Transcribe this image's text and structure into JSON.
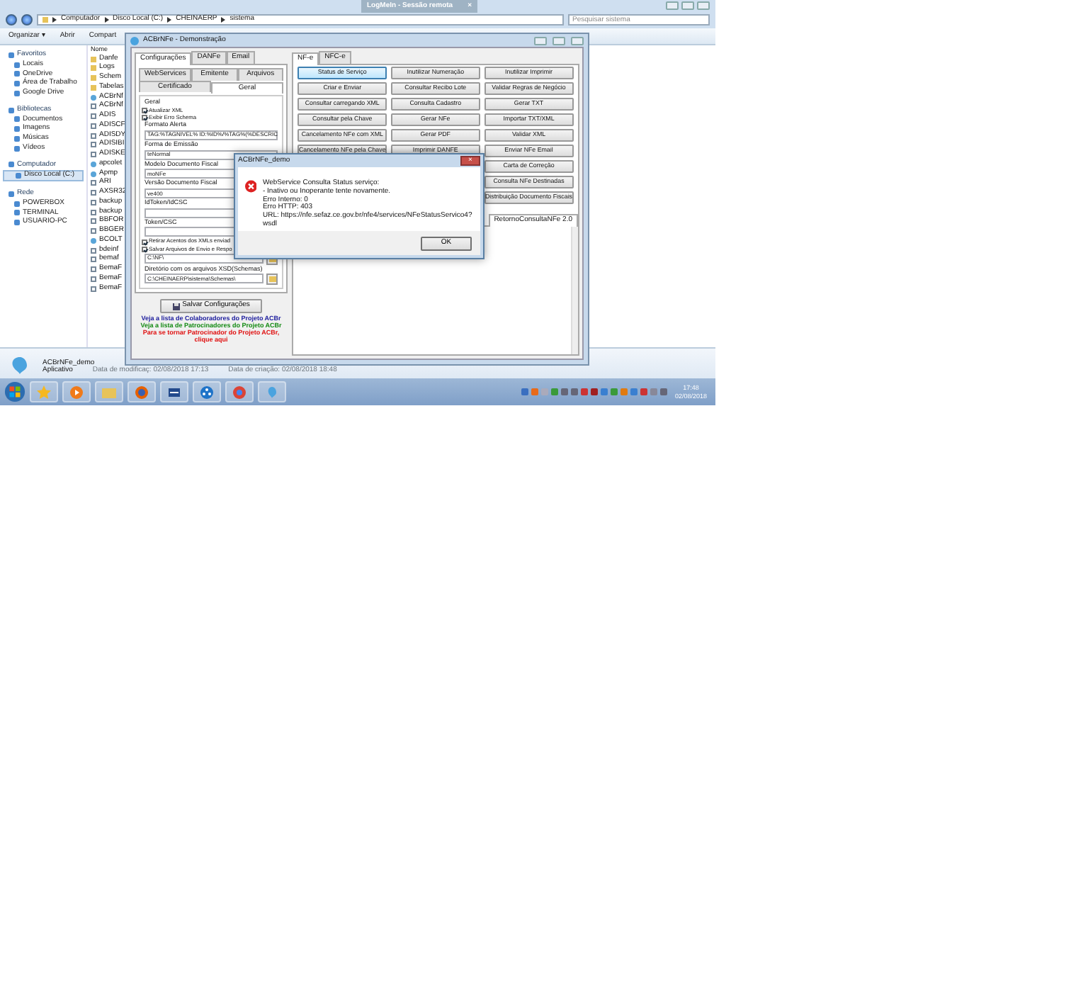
{
  "explorer": {
    "address": [
      "Computador",
      "Disco Local (C:)",
      "CHEINAERP",
      "sistema"
    ],
    "search": {
      "placeholder": "Pesquisar sistema"
    },
    "toolbar": [
      "Organizar ▾",
      "Abrir",
      "Compart"
    ],
    "sidebar": [
      {
        "label": "Favoritos",
        "children": [
          {
            "label": "Locais",
            "selected": false
          },
          {
            "label": "OneDrive",
            "selected": false
          },
          {
            "label": "Área de Trabalho",
            "selected": false
          },
          {
            "label": "Google Drive",
            "selected": false
          }
        ]
      },
      {
        "label": "Bibliotecas",
        "children": [
          {
            "label": "Documentos",
            "selected": false
          },
          {
            "label": "Imagens",
            "selected": false
          },
          {
            "label": "Músicas",
            "selected": false
          },
          {
            "label": "Vídeos",
            "selected": false
          }
        ]
      },
      {
        "label": "Computador",
        "children": [
          {
            "label": "Disco Local (C:)",
            "selected": true
          }
        ]
      },
      {
        "label": "Rede",
        "children": [
          {
            "label": "POWERBOX",
            "selected": false
          },
          {
            "label": "TERMINAL",
            "selected": false
          },
          {
            "label": "USUARIO-PC",
            "selected": false
          }
        ]
      }
    ],
    "column": "Nome",
    "files": [
      {
        "name": "Danfe",
        "kind": "folder"
      },
      {
        "name": "Logs",
        "kind": "folder"
      },
      {
        "name": "Schem",
        "kind": "folder"
      },
      {
        "name": "Tabelas",
        "kind": "folder"
      },
      {
        "name": "ACBrNf",
        "kind": "app"
      },
      {
        "name": "ACBrNf",
        "kind": "file"
      },
      {
        "name": "ADIS",
        "kind": "file"
      },
      {
        "name": "ADISCF",
        "kind": "file"
      },
      {
        "name": "ADISDY",
        "kind": "file"
      },
      {
        "name": "ADISIBI",
        "kind": "file"
      },
      {
        "name": "ADISKE",
        "kind": "file"
      },
      {
        "name": "apcolet",
        "kind": "app"
      },
      {
        "name": "Apmp",
        "kind": "app"
      },
      {
        "name": "ARI",
        "kind": "file"
      },
      {
        "name": "AXSR32",
        "kind": "file"
      },
      {
        "name": "backup",
        "kind": "file"
      },
      {
        "name": "backup",
        "kind": "file"
      },
      {
        "name": "BBFOR",
        "kind": "file"
      },
      {
        "name": "BBGER",
        "kind": "file"
      },
      {
        "name": "BCOLT",
        "kind": "app"
      },
      {
        "name": "bdeinf",
        "kind": "file"
      },
      {
        "name": "bemaf",
        "kind": "file"
      },
      {
        "name": "BemaF",
        "kind": "file"
      },
      {
        "name": "BemaF",
        "kind": "file"
      },
      {
        "name": "BemaF",
        "kind": "file"
      }
    ],
    "details": {
      "name": "ACBrNFe_demo",
      "type": "Aplicativo",
      "modified": "Data de modificaç: 02/08/2018 17:13",
      "created": "Data de criação: 02/08/2018 18:48"
    }
  },
  "remote_tab": {
    "title": "LogMeIn - Sessão remota",
    "close": "×"
  },
  "acbr": {
    "title": "ACBrNFe - Demonstração",
    "config_tabs": [
      {
        "label": "Configurações",
        "selected": true
      },
      {
        "label": "DANFe",
        "selected": false
      },
      {
        "label": "Email",
        "selected": false
      }
    ],
    "sub_tabs": [
      [
        {
          "label": "WebServices",
          "selected": false
        },
        {
          "label": "Emitente",
          "selected": false
        },
        {
          "label": "Arquivos",
          "selected": false
        }
      ],
      [
        {
          "label": "Certificado",
          "selected": false
        },
        {
          "label": "Geral",
          "selected": true
        }
      ]
    ],
    "group": "Geral",
    "fields": [
      {
        "kind": "check",
        "label": "Atualizar XML",
        "checked": true
      },
      {
        "kind": "check",
        "label": "Exibir Erro Schema",
        "checked": true
      },
      {
        "kind": "text",
        "label": "Formato Alerta",
        "value": "TAG:%TAGNIVEL% ID:%ID%/%TAG%(%DESCRIC"
      },
      {
        "kind": "select",
        "label": "Forma de Emissão",
        "value": "teNormal"
      },
      {
        "kind": "text",
        "label": "Modelo Documento Fiscal",
        "value": "moNFe"
      },
      {
        "kind": "text",
        "label": "Versão Documento Fiscal",
        "value": "ve400"
      },
      {
        "kind": "text",
        "label": "IdToken/IdCSC"
      },
      {
        "kind": "text",
        "label": "Token/CSC"
      },
      {
        "kind": "check",
        "label": "Retirar Acentos dos XMLs enviad",
        "checked": true
      },
      {
        "kind": "check",
        "label": "Salvar Arquivos de Envio e Respo",
        "checked": true
      },
      {
        "kind": "path",
        "value": "C:\\NF\\"
      },
      {
        "kind": "path",
        "label": "Diretório com os arquivos XSD(Schemas)",
        "value": "C:\\CHEINAERP\\sistema\\Schemas\\"
      }
    ],
    "save": "Salvar Configurações",
    "links": [
      {
        "text": "Veja a lista de Colaboradores do Projeto ACBr",
        "color": "#1a1a9c"
      },
      {
        "text": "Veja a lista de Patrocinadores do Projeto ACBr",
        "color": "#138a13"
      },
      {
        "text": "Para se tornar Patrocinador do Projeto ACBr, clique aqui",
        "color": "#e01010"
      }
    ],
    "nfe_tabs": [
      {
        "label": "NF-e",
        "selected": true
      },
      {
        "label": "NFC-e",
        "selected": false
      }
    ],
    "action_columns": [
      [
        {
          "label": "Status de Serviço",
          "focused": true
        },
        {
          "label": "Criar e Enviar",
          "focused": false
        },
        {
          "label": "Consultar carregando XML",
          "focused": false
        },
        {
          "label": "Consultar pela Chave",
          "focused": false
        },
        {
          "label": "Cancelamento NFe com XML",
          "focused": false
        },
        {
          "label": "Cancelamento NFe pela Chave",
          "focused": false
        }
      ],
      [
        {
          "label": "Inutilizar Numeração",
          "focused": false
        },
        {
          "label": "Consultar Recibo Lote",
          "focused": false
        },
        {
          "label": "Consulta Cadastro",
          "focused": false
        },
        {
          "label": "Gerar NFe",
          "focused": false
        },
        {
          "label": "Gerar PDF",
          "focused": false
        },
        {
          "label": "Imprimir DANFE",
          "focused": false
        }
      ],
      [
        {
          "label": "Inutilizar Imprimir",
          "focused": false
        },
        {
          "label": "Validar Regras de Negócio",
          "focused": false
        },
        {
          "label": "Gerar TXT",
          "focused": false
        },
        {
          "label": "Importar TXT/XML",
          "focused": false
        },
        {
          "label": "Validar XML",
          "focused": false
        },
        {
          "label": "Enviar NFe Email",
          "focused": false
        },
        {
          "label": "Carta de Correção",
          "focused": false
        },
        {
          "label": "Consulta NFe Destinadas",
          "focused": false
        },
        {
          "label": "Distribuição Documento Fiscais",
          "focused": false
        }
      ]
    ],
    "result_tab": "RetornoConsultaNFe 2.0"
  },
  "dialog": {
    "title": "ACBrNFe_demo",
    "close": "×",
    "lines": [
      "WebService Consulta Status serviço:",
      "- Inativo ou Inoperante tente novamente.",
      "Erro Interno: 0",
      "Erro HTTP: 403",
      "URL: https://nfe.sefaz.ce.gov.br/nfe4/services/NFeStatusServico4?wsdl"
    ],
    "ok": "OK"
  },
  "clock": {
    "time": "17:48",
    "date": "02/08/2018"
  }
}
